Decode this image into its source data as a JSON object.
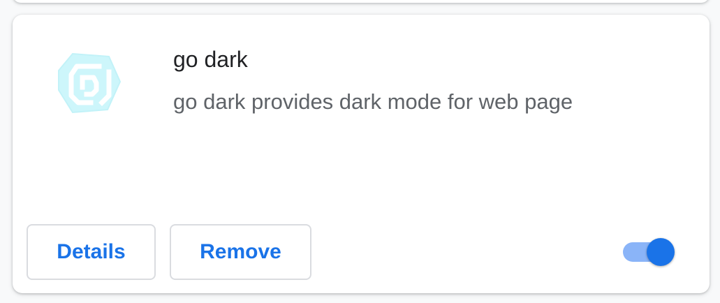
{
  "extension": {
    "name": "go dark",
    "description": "go dark provides dark mode for web page",
    "icon": "go-dark-logo-icon",
    "enabled": true
  },
  "actions": {
    "details_label": "Details",
    "remove_label": "Remove"
  },
  "colors": {
    "accent": "#1a73e8",
    "toggle_track": "#8ab4f8",
    "icon_fill": "#cdf6fb",
    "name_text": "#202124",
    "desc_text": "#5f6368"
  }
}
